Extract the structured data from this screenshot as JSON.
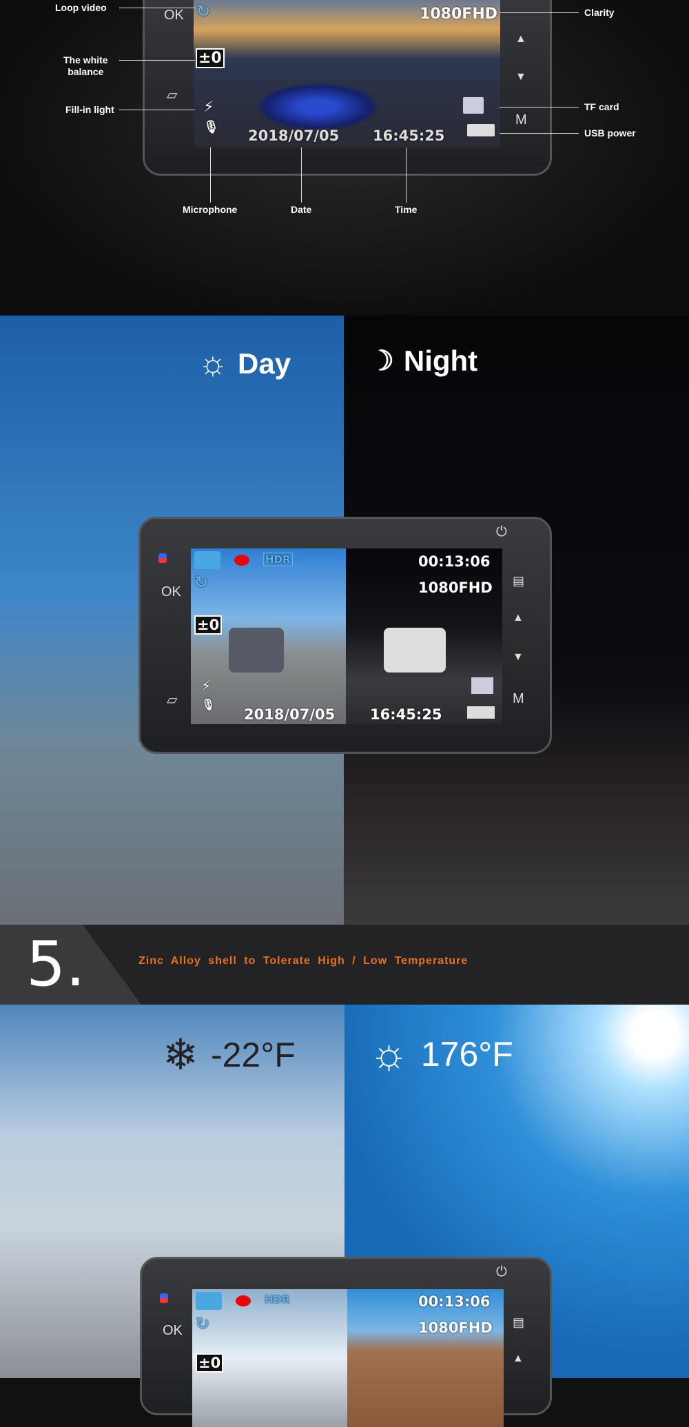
{
  "section1": {
    "callouts": {
      "loop_video": "Loop video",
      "white_balance": "The white\nbalance",
      "fill_in_light": "Fill-in light",
      "microphone": "Microphone",
      "date": "Date",
      "time": "Time",
      "clarity": "Clarity",
      "tf_card": "TF card",
      "usb_power": "USB power"
    },
    "osd": {
      "resolution": "1080FHD",
      "date": "2018/07/05",
      "time": "16:45:25",
      "ev": "±0"
    },
    "buttons": {
      "ok": "OK",
      "m": "M",
      "up": "▲",
      "down": "▼"
    }
  },
  "section2": {
    "day_label": "Day",
    "night_label": "Night",
    "osd": {
      "hdr": "HDR",
      "timer": "00:13:06",
      "resolution": "1080FHD",
      "ev": "±0",
      "date": "2018/07/05",
      "time": "16:45:25"
    },
    "buttons": {
      "ok": "OK",
      "m": "M",
      "up": "▲",
      "down": "▼",
      "power": "⏻"
    }
  },
  "banner": {
    "number": "5.",
    "text": "Zinc Alloy shell to Tolerate High / Low Temperature",
    "text_color": "#e8731f"
  },
  "section3": {
    "cold_temp": "-22°F",
    "hot_temp": "176°F",
    "osd": {
      "hdr": "HDR",
      "timer": "00:13:06",
      "resolution": "1080FHD",
      "ev": "±0"
    },
    "buttons": {
      "ok": "OK",
      "up": "▲",
      "power": "⏻"
    }
  }
}
